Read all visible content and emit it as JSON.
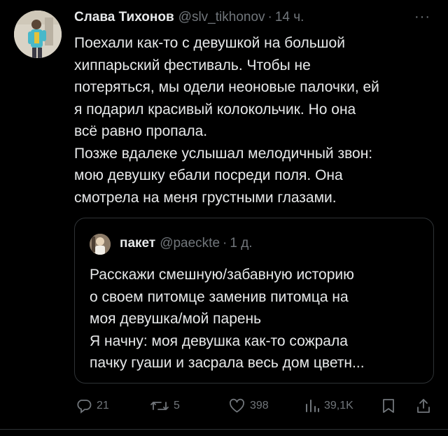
{
  "tweet": {
    "author_name": "Слава Тихонов",
    "author_handle": "@slv_tikhonov",
    "separator": "·",
    "time": "14 ч.",
    "more_label": "···",
    "text_lines": [
      "Поехали как-то с девушкой на большой",
      "хиппарьский фестиваль. Чтобы не",
      "потеряться, мы одели неоновые палочки, ей",
      "я подарил красивый колокольчик. Но она",
      "всё равно пропала.",
      "Позже вдалеке услышал мелодичный звон:",
      "мою девушку ебали посреди поля. Она",
      "смотрела на меня грустными глазами."
    ]
  },
  "quote": {
    "author_name": "пакет",
    "author_handle": "@paeckte",
    "separator": "·",
    "time": "1 д.",
    "text_lines": [
      "Расскажи смешную/забавную историю",
      "о своем питомце заменив питомца на",
      "моя девушка/мой парень",
      "Я начну: моя девушка как-то сожрала",
      "пачку гуаши и засрала весь дом цветн..."
    ]
  },
  "actions": {
    "reply": "21",
    "retweet": "5",
    "like": "398",
    "views": "39,1K",
    "bookmark_icon": "bookmark-icon",
    "share_icon": "share-icon"
  },
  "colors": {
    "background": "#000000",
    "text": "#e7e9ea",
    "muted": "#71767b",
    "border": "#2f3336"
  }
}
